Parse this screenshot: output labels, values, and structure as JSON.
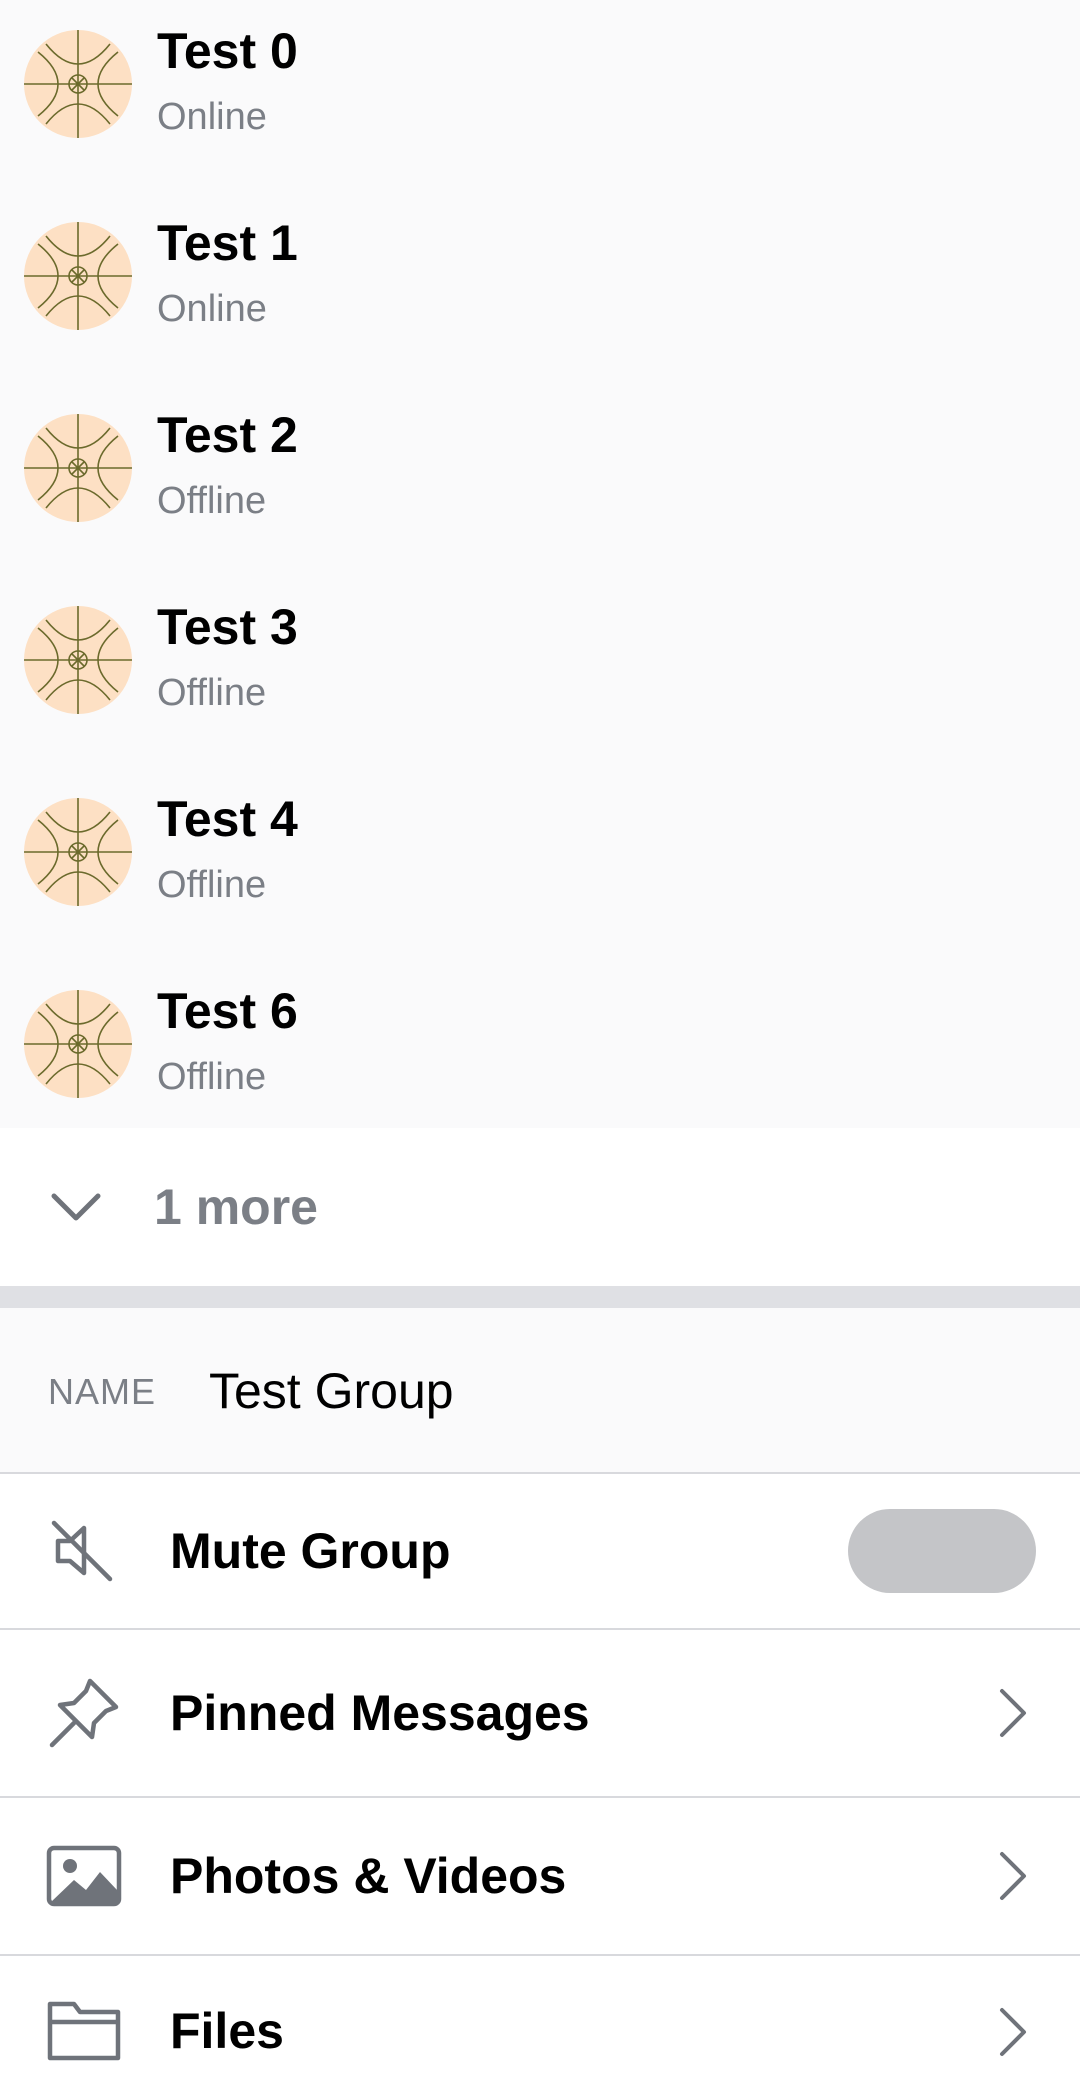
{
  "members": [
    {
      "name": "Test 0",
      "status": "Online"
    },
    {
      "name": "Test 1",
      "status": "Online"
    },
    {
      "name": "Test 2",
      "status": "Offline"
    },
    {
      "name": "Test 3",
      "status": "Offline"
    },
    {
      "name": "Test 4",
      "status": "Offline"
    },
    {
      "name": "Test 6",
      "status": "Offline"
    }
  ],
  "more": {
    "label": "1 more",
    "icon": "chevron-down-icon"
  },
  "group": {
    "name_label": "NAME",
    "name_value": "Test Group"
  },
  "settings": {
    "mute": {
      "label": "Mute Group",
      "icon": "muted-speaker-icon",
      "toggle_on": false
    },
    "pinned": {
      "label": "Pinned Messages",
      "icon": "pin-icon"
    },
    "photos": {
      "label": "Photos & Videos",
      "icon": "image-icon"
    },
    "files": {
      "label": "Files",
      "icon": "folder-icon"
    }
  },
  "colors": {
    "list_background": "#fafafb",
    "secondary_text": "#7b7f86",
    "avatar_fill": "#fde0c4",
    "avatar_lines": "#6b6a2c",
    "toggle_off": "#c4c5c8",
    "separator": "#dfe0e4"
  }
}
